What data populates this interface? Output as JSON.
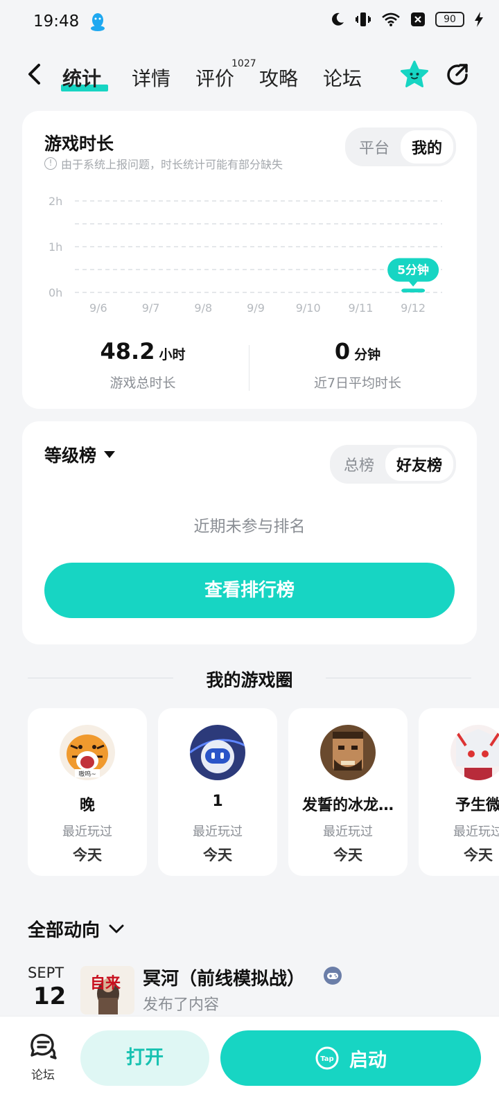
{
  "status_bar": {
    "time": "19:48",
    "battery": "90",
    "icons": [
      "qq-penguin-icon",
      "moon-icon",
      "vibrate-icon",
      "wifi-icon",
      "sim-off-icon",
      "battery-icon",
      "charging-icon"
    ]
  },
  "nav": {
    "tabs": [
      {
        "label": "统计",
        "active": true
      },
      {
        "label": "详情"
      },
      {
        "label": "评价",
        "badge": "1027"
      },
      {
        "label": "攻略"
      },
      {
        "label": "论坛"
      }
    ],
    "icons": [
      "back-icon",
      "star-icon",
      "share-icon"
    ]
  },
  "playtime": {
    "title": "游戏时长",
    "note": "由于系统上报问题，时长统计可能有部分缺失",
    "toggle": [
      "平台",
      "我的"
    ],
    "toggle_selected": "我的",
    "total_value": "48.2",
    "total_unit": "小时",
    "total_label": "游戏总时长",
    "avg_value": "0",
    "avg_unit": "分钟",
    "avg_label": "近7日平均时长"
  },
  "chart_data": {
    "type": "bar",
    "categories": [
      "9/6",
      "9/7",
      "9/8",
      "9/9",
      "9/10",
      "9/11",
      "9/12"
    ],
    "values": [
      0,
      0,
      0,
      0,
      0,
      0,
      0.083
    ],
    "y_ticks": [
      "2h",
      "1h",
      "0h"
    ],
    "ylim": [
      0,
      2
    ],
    "annotation": "5分钟",
    "grid": true,
    "accent": "#17d5c3"
  },
  "rank": {
    "title": "等级榜",
    "toggle": [
      "总榜",
      "好友榜"
    ],
    "toggle_selected": "好友榜",
    "empty_text": "近期未参与排名",
    "button_label": "查看排行榜"
  },
  "game_circle": {
    "title": "我的游戏圈",
    "friends": [
      {
        "name": "晚",
        "sub": "最近玩过",
        "day": "今天",
        "avatar_caption": "嗷呜~"
      },
      {
        "name": "1",
        "sub": "最近玩过",
        "day": "今天"
      },
      {
        "name": "发誓的冰龙…",
        "sub": "最近玩过",
        "day": "今天"
      },
      {
        "name": "予生微",
        "sub": "最近玩过",
        "day": "今天"
      }
    ]
  },
  "feed": {
    "header": "全部动向",
    "month": "SEPT",
    "day": "12",
    "avatar_text": "自来",
    "title": "冥河（前线模拟战）",
    "subtitle": "发布了内容"
  },
  "bottom_bar": {
    "forum_label": "论坛",
    "open_label": "打开",
    "start_label": "启动",
    "tap_logo": "Tap"
  }
}
